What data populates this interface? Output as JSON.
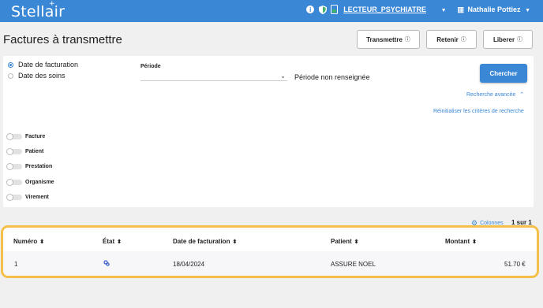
{
  "header": {
    "logo": "Stellair",
    "logo_star": "+",
    "reader": "LECTEUR_PSYCHIATRE",
    "user": "Nathalie Pottiez",
    "info_icon": "info-icon",
    "shield_icon": "shield-icon",
    "card_icon": "card-reader-icon",
    "accent": "#3a87d6"
  },
  "page": {
    "title": "Factures à transmettre"
  },
  "actions": {
    "transmettre": "Transmettre",
    "retenir": "Retenir",
    "liberer": "Liberer"
  },
  "filters": {
    "radio_date_facturation": "Date de facturation",
    "radio_date_soins": "Date des soins",
    "periode_label": "Période",
    "periode_value": "Période non renseignée",
    "search": "Chercher",
    "advanced": "Recherche avancée",
    "reset": "Réinitialiser les critères de recherche",
    "toggles": [
      "Facture",
      "Patient",
      "Prestation",
      "Organisme",
      "Virement"
    ]
  },
  "table": {
    "columns_link": "Colonnes",
    "page_info": "1 sur 1",
    "headers": [
      "Numéro",
      "État",
      "Date de facturation",
      "Patient",
      "Montant"
    ],
    "rows": [
      {
        "numero": "1",
        "etat_icon": "sync-icon",
        "date": "18/04/2024",
        "patient": "ASSURE NOEL",
        "montant": "51.70 €"
      }
    ],
    "highlight_color": "#f5c04a"
  }
}
